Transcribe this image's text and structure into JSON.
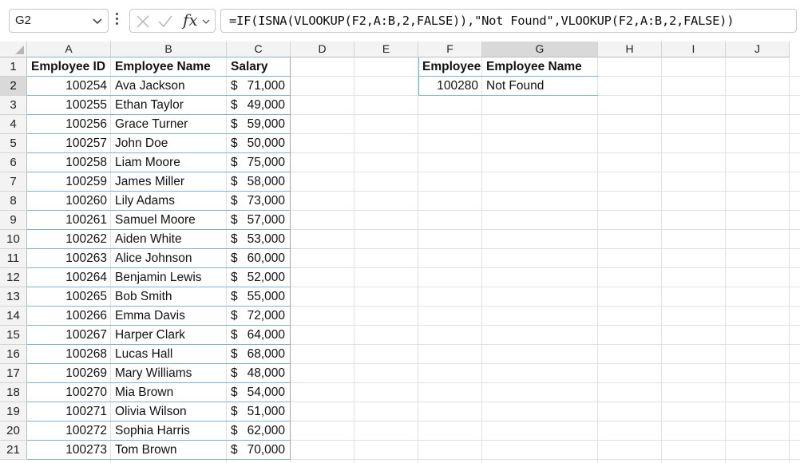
{
  "name_box": {
    "value": "G2"
  },
  "formula_bar": {
    "cancel_icon": "close-icon",
    "enter_icon": "check-icon",
    "function_label": "fx",
    "formula": "=IF(ISNA(VLOOKUP(F2,A:B,2,FALSE)),\"Not Found\",VLOOKUP(F2,A:B,2,FALSE))"
  },
  "columns": [
    "A",
    "B",
    "C",
    "D",
    "E",
    "F",
    "G",
    "H",
    "I",
    "J"
  ],
  "rows": [
    "1",
    "2",
    "3",
    "4",
    "5",
    "6",
    "7",
    "8",
    "9",
    "10",
    "11",
    "12",
    "13",
    "14",
    "15",
    "16",
    "17",
    "18",
    "19",
    "20",
    "21"
  ],
  "selected_cell": {
    "column": "G",
    "row": "2"
  },
  "table": {
    "headers": [
      "Employee ID",
      "Employee Name",
      "Salary"
    ],
    "currency_symbol": "$",
    "rows": [
      [
        "100254",
        "Ava Jackson",
        "71,000"
      ],
      [
        "100255",
        "Ethan Taylor",
        "49,000"
      ],
      [
        "100256",
        "Grace Turner",
        "59,000"
      ],
      [
        "100257",
        "John Doe",
        "50,000"
      ],
      [
        "100258",
        "Liam Moore",
        "75,000"
      ],
      [
        "100259",
        "James Miller",
        "58,000"
      ],
      [
        "100260",
        "Lily Adams",
        "73,000"
      ],
      [
        "100261",
        "Samuel Moore",
        "57,000"
      ],
      [
        "100262",
        "Aiden White",
        "53,000"
      ],
      [
        "100263",
        "Alice Johnson",
        "60,000"
      ],
      [
        "100264",
        "Benjamin Lewis",
        "52,000"
      ],
      [
        "100265",
        "Bob Smith",
        "55,000"
      ],
      [
        "100266",
        "Emma Davis",
        "72,000"
      ],
      [
        "100267",
        "Harper Clark",
        "64,000"
      ],
      [
        "100268",
        "Lucas Hall",
        "68,000"
      ],
      [
        "100269",
        "Mary Williams",
        "48,000"
      ],
      [
        "100270",
        "Mia Brown",
        "54,000"
      ],
      [
        "100271",
        "Olivia Wilson",
        "51,000"
      ],
      [
        "100272",
        "Sophia Harris",
        "62,000"
      ],
      [
        "100273",
        "Tom Brown",
        "70,000"
      ]
    ]
  },
  "lookup": {
    "headers": [
      "Employee",
      "Employee Name"
    ],
    "id_value": "100280",
    "result": "Not Found"
  },
  "colors": {
    "table_border": "#7fb0cc",
    "gridline": "#e1e1e1",
    "header_bg": "#f3f3f3",
    "selected_header_bg": "#d9d9d9"
  }
}
